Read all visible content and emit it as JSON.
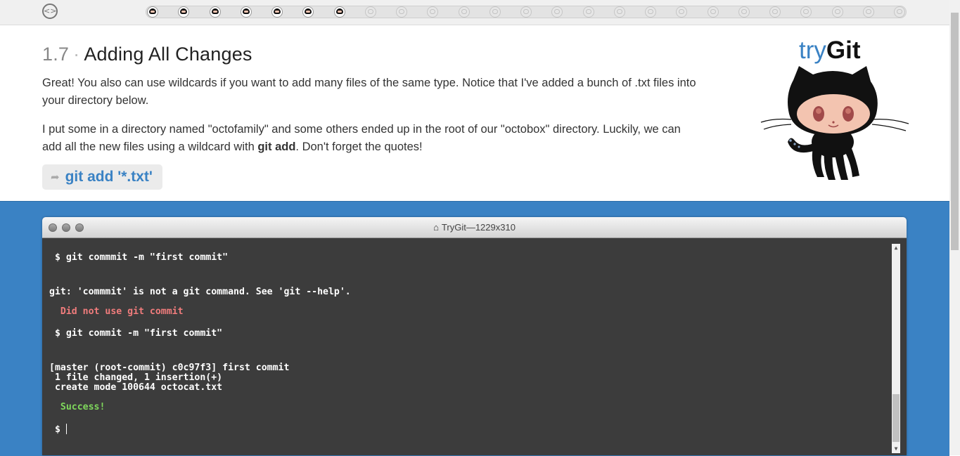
{
  "progress": {
    "total_steps": 25,
    "completed_steps": 7
  },
  "lesson": {
    "number": "1.7",
    "title": "Adding All Changes",
    "para1": "Great! You also can use wildcards if you want to add many files of the same type. Notice that I've added a bunch of .txt files into your directory below.",
    "para2_before": "I put some in a directory named \"octofamily\" and some others ended up in the root of our \"octobox\" directory. Luckily, we can add all the new files using a wildcard with ",
    "para2_bold": "git add",
    "para2_after": ". Don't forget the quotes!",
    "command": "git add '*.txt'"
  },
  "logo": {
    "try": "try",
    "git": "Git"
  },
  "window": {
    "title": "TryGit—1229x310"
  },
  "console": {
    "cmd1": " $ git commmit -m \"first commit\"",
    "out1": "git: 'commmit' is not a git command. See 'git --help'.",
    "hint1": "  Did not use git commit",
    "cmd2": " $ git commit -m \"first commit\"",
    "out2a": "[master (root-commit) c0c97f3] first commit",
    "out2b": " 1 file changed, 1 insertion(+)",
    "out2c": " create mode 100644 octocat.txt",
    "success": "  Success!",
    "prompt": " $ "
  },
  "colors": {
    "accent_blue": "#3a82c4",
    "console_bg": "#3c3c3c",
    "error_text": "#f07c7c",
    "success_text": "#7fd85c"
  },
  "icons": [
    "home-icon",
    "octocat-icon",
    "arrow-icon",
    "window-home-icon"
  ]
}
